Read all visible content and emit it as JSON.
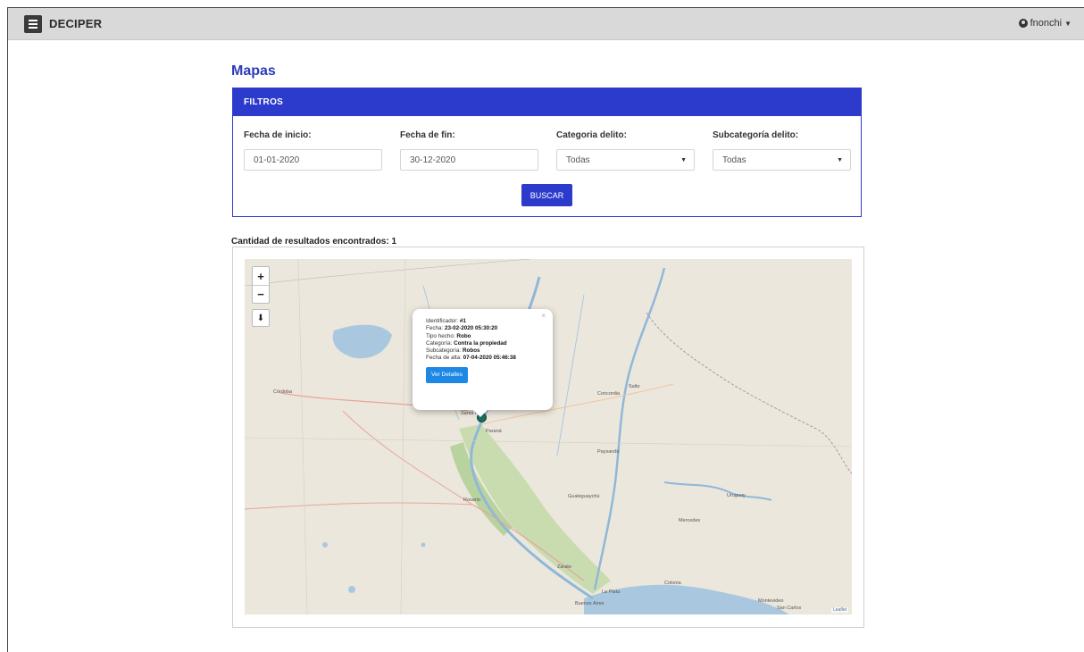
{
  "app": {
    "brand": "DECIPER",
    "user": "fnonchi"
  },
  "page": {
    "title": "Mapas"
  },
  "filters": {
    "header": "FILTROS",
    "fecha_inicio": {
      "label": "Fecha de inicio:",
      "value": "01-01-2020"
    },
    "fecha_fin": {
      "label": "Fecha de fin:",
      "value": "30-12-2020"
    },
    "categoria": {
      "label": "Categoria delito:",
      "value": "Todas"
    },
    "subcategoria": {
      "label": "Subcategoría delito:",
      "value": "Todas"
    },
    "search_label": "BUSCAR"
  },
  "results": {
    "text": "Cantidad de resultados encontrados: 1"
  },
  "map": {
    "zoom_in": "+",
    "zoom_out": "−",
    "download_icon": "download-icon",
    "attribution": "Leaflet",
    "labels": {
      "cordoba": "Córdoba",
      "santa_fe": "Santa Fe",
      "rosario": "Rosario",
      "buenos_aires": "Buenos Aires",
      "uruguay": "Uruguay",
      "parana": "Paraná",
      "concordia": "Concordia",
      "salto": "Salto",
      "paysandu": "Paysandú",
      "gualeguaychu": "Gualeguaychú",
      "zarate": "Zárate",
      "la_plata": "La Plata",
      "montevideo": "Montevideo",
      "colonia": "Colonia",
      "san_carlos": "San Carlos",
      "mercedes": "Mercedes"
    },
    "popup": {
      "id_label": "Identificador:",
      "id_value": "#1",
      "fecha_label": "Fecha:",
      "fecha_value": "23-02-2020 05:30:20",
      "tipo_label": "Tipo hecho:",
      "tipo_value": "Robo",
      "categoria_label": "Categoría:",
      "categoria_value": "Contra la propiedad",
      "subcategoria_label": "Subcategoría:",
      "subcategoria_value": "Robos",
      "alta_label": "Fecha de alta:",
      "alta_value": "07-04-2020 05:46:38",
      "button": "Ver Detalles",
      "close": "×"
    }
  },
  "colors": {
    "accent": "#2c3bcc",
    "button_blue": "#1e88e5",
    "topbar": "#d9d9d9"
  }
}
